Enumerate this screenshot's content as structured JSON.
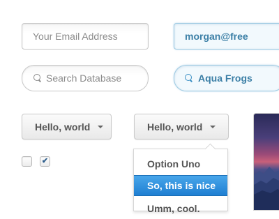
{
  "form": {
    "email_placeholder": "Your Email Address",
    "email_value": "morgan@free",
    "search_placeholder": "Search Database",
    "search_value": "Aqua Frogs"
  },
  "dropdowns": {
    "first_label": "Hello, world",
    "second_label": "Hello, world",
    "options": [
      "Option Uno",
      "So, this is nice",
      "Umm, cool."
    ],
    "selected_option": "So, this is nice"
  },
  "checkboxes": {
    "first_checked": false,
    "second_checked": true,
    "check_glyph": "✔"
  },
  "colors": {
    "accent": "#1f7fd2",
    "active_field_text": "#3b7fa6"
  }
}
